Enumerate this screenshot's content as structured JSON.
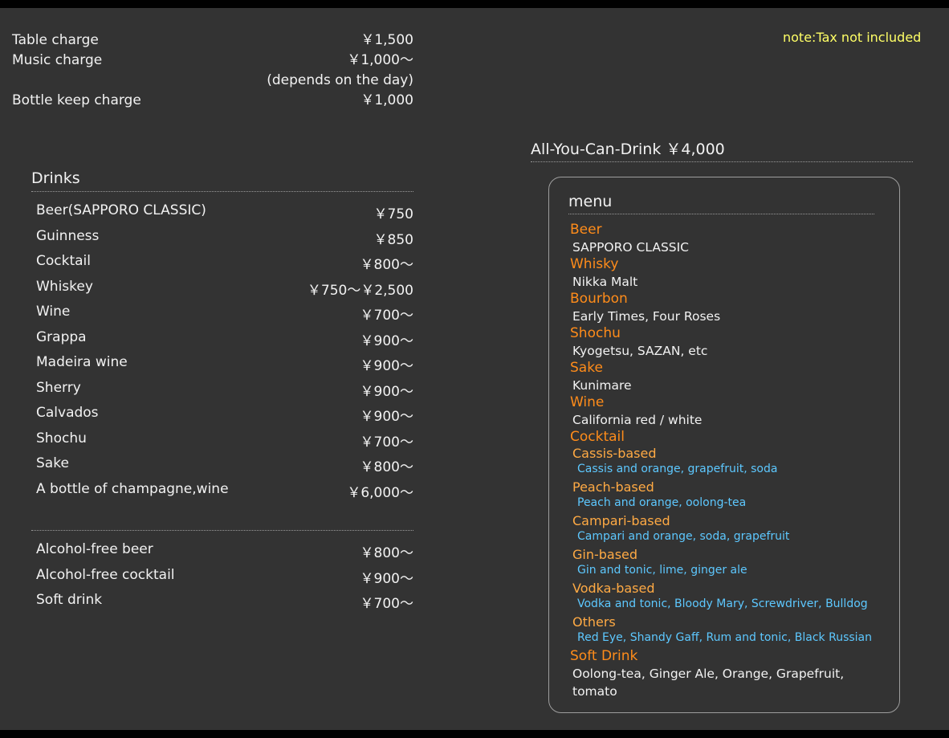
{
  "charges": {
    "table": {
      "label": "Table charge",
      "price": "￥1,500"
    },
    "music": {
      "label": "Music charge",
      "price": "￥1,000～",
      "note": "(depends on the day)"
    },
    "bottle_keep": {
      "label": "Bottle keep charge",
      "price": "￥1,000"
    }
  },
  "tax_note": "note:Tax not included",
  "drinks": {
    "title": "Drinks",
    "items": [
      {
        "name": "Beer(SAPPORO CLASSIC)",
        "price": "￥750"
      },
      {
        "name": "Guinness",
        "price": "￥850"
      },
      {
        "name": "Cocktail",
        "price": "￥800～"
      },
      {
        "name": "Whiskey",
        "price": "￥750～￥2,500"
      },
      {
        "name": "Wine",
        "price": "￥700～"
      },
      {
        "name": "Grappa",
        "price": "￥900～"
      },
      {
        "name": "Madeira wine",
        "price": "￥900～"
      },
      {
        "name": "Sherry",
        "price": "￥900～"
      },
      {
        "name": "Calvados",
        "price": "￥900～"
      },
      {
        "name": "Shochu",
        "price": "￥700～"
      },
      {
        "name": "Sake",
        "price": "￥800～"
      },
      {
        "name": "A bottle of champagne,wine",
        "price": "￥6,000～"
      }
    ],
    "non_alcoholic": [
      {
        "name": "Alcohol-free beer",
        "price": "￥800～"
      },
      {
        "name": "Alcohol-free cocktail",
        "price": "￥900～"
      },
      {
        "name": "Soft drink",
        "price": "￥700～"
      }
    ]
  },
  "all_you_can_drink": {
    "title": "All-You-Can-Drink ￥4,000",
    "menu_title": "menu",
    "categories": {
      "beer": {
        "name": "Beer",
        "items": "SAPPORO CLASSIC"
      },
      "whisky": {
        "name": "Whisky",
        "items": "Nikka Malt"
      },
      "bourbon": {
        "name": "Bourbon",
        "items": "Early Times, Four Roses"
      },
      "shochu": {
        "name": "Shochu",
        "items": "Kyogetsu, SAZAN, etc"
      },
      "sake": {
        "name": "Sake",
        "items": "Kunimare"
      },
      "wine": {
        "name": "Wine",
        "items": "California red / white"
      },
      "cocktail": {
        "name": "Cocktail",
        "subs": [
          {
            "name": "Cassis-based",
            "items": "Cassis and orange, grapefruit, soda"
          },
          {
            "name": "Peach-based",
            "items": "Peach and orange, oolong-tea"
          },
          {
            "name": "Campari-based",
            "items": "Campari and orange, soda, grapefruit"
          },
          {
            "name": "Gin-based",
            "items": "Gin and tonic, lime, ginger ale"
          },
          {
            "name": "Vodka-based",
            "items": "Vodka and tonic, Bloody Mary, Screwdriver, Bulldog"
          },
          {
            "name": "Others",
            "items": "Red Eye, Shandy Gaff, Rum and tonic, Black Russian"
          }
        ]
      },
      "soft_drink": {
        "name": "Soft Drink",
        "items": "Oolong-tea, Ginger Ale, Orange, Grapefruit, tomato"
      }
    }
  },
  "colors": {
    "background": "#333333",
    "frame": "#000000",
    "text": "#f2f2f2",
    "note": "#ffff66",
    "category": "#ff8c1a",
    "sub_category": "#ffaa44",
    "sub_items": "#5dc8ff"
  }
}
